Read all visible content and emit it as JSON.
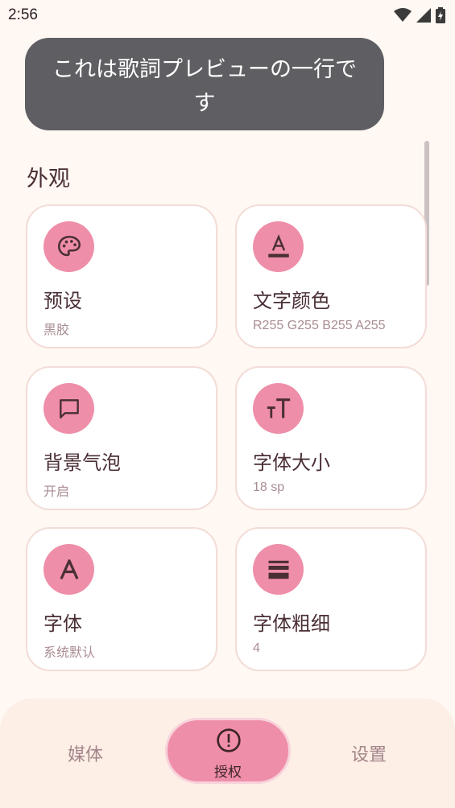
{
  "status_bar": {
    "time": "2:56"
  },
  "toast": {
    "text": "これは歌詞プレビューの一行です"
  },
  "section": {
    "title": "外观"
  },
  "cards": [
    {
      "title": "预设",
      "subtitle": "黑胶",
      "icon": "palette-icon"
    },
    {
      "title": "文字颜色",
      "subtitle": "R255 G255 B255 A255",
      "icon": "text-color-icon"
    },
    {
      "title": "背景气泡",
      "subtitle": "开启",
      "icon": "chat-bubble-icon"
    },
    {
      "title": "字体大小",
      "subtitle": "18 sp",
      "icon": "font-size-icon"
    },
    {
      "title": "字体",
      "subtitle": "系统默认",
      "icon": "font-icon"
    },
    {
      "title": "字体粗细",
      "subtitle": "4",
      "icon": "font-weight-icon"
    }
  ],
  "nav": {
    "media": "媒体",
    "auth": "授权",
    "settings": "设置"
  },
  "colors": {
    "accent": "#ef8ea8",
    "background": "#fff8f3",
    "toast_bg": "#5f5f63",
    "nav_bg": "#fdeee6"
  }
}
